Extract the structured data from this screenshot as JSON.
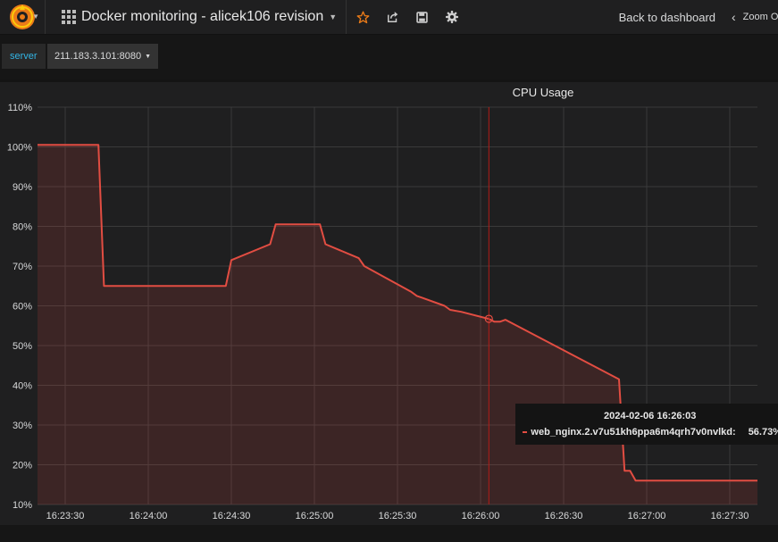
{
  "topbar": {
    "dashboard_title": "Docker monitoring - alicek106 revision",
    "back_label": "Back to dashboard",
    "zoom_label": "Zoom Out",
    "icons": [
      "grafana-logo",
      "dashboard-grid-icon",
      "star-icon",
      "share-icon",
      "save-icon",
      "gear-icon",
      "chevron-left-icon"
    ],
    "star_color": "#eb7b18"
  },
  "variables": {
    "label": "server",
    "value": "211.183.3.101:8080"
  },
  "panel": {
    "title": "CPU Usage"
  },
  "tooltip": {
    "time": "2024-02-06 16:26:03",
    "series": "web_nginx.2.v7u51kh6ppa6m4qrh7v0nvlkd:",
    "value": "56.73%"
  },
  "chart_data": {
    "type": "area",
    "title": "CPU Usage",
    "series_color": "#e24d42",
    "grid": true,
    "y_unit": "%",
    "ylim": [
      10,
      110
    ],
    "y_ticks": [
      "10%",
      "20%",
      "30%",
      "40%",
      "50%",
      "60%",
      "70%",
      "80%",
      "90%",
      "100%",
      "110%"
    ],
    "xlim": [
      "16:23:20",
      "16:27:40"
    ],
    "x_ticks": [
      "16:23:30",
      "16:24:00",
      "16:24:30",
      "16:25:00",
      "16:25:30",
      "16:26:00",
      "16:26:30",
      "16:27:00",
      "16:27:30"
    ],
    "crosshair_x": "16:26:03",
    "series": [
      {
        "name": "web_nginx.2.v7u51kh6ppa6m4qrh7v0nvlkd",
        "x": [
          "16:23:20",
          "16:23:42",
          "16:23:44",
          "16:24:28",
          "16:24:30",
          "16:24:44",
          "16:24:46",
          "16:25:02",
          "16:25:04",
          "16:25:16",
          "16:25:18",
          "16:25:35",
          "16:25:37",
          "16:25:39",
          "16:25:47",
          "16:25:49",
          "16:25:53",
          "16:26:03",
          "16:26:05",
          "16:26:07",
          "16:26:09",
          "16:26:50",
          "16:26:52",
          "16:26:54",
          "16:26:56",
          "16:27:40"
        ],
        "y": [
          100.5,
          100.5,
          65,
          65,
          71.5,
          75.5,
          80.5,
          80.5,
          75.5,
          72,
          70,
          63.5,
          62.5,
          62,
          60,
          59,
          58.5,
          56.73,
          56,
          56,
          56.5,
          41.5,
          18.5,
          18.5,
          16,
          16
        ]
      }
    ]
  }
}
